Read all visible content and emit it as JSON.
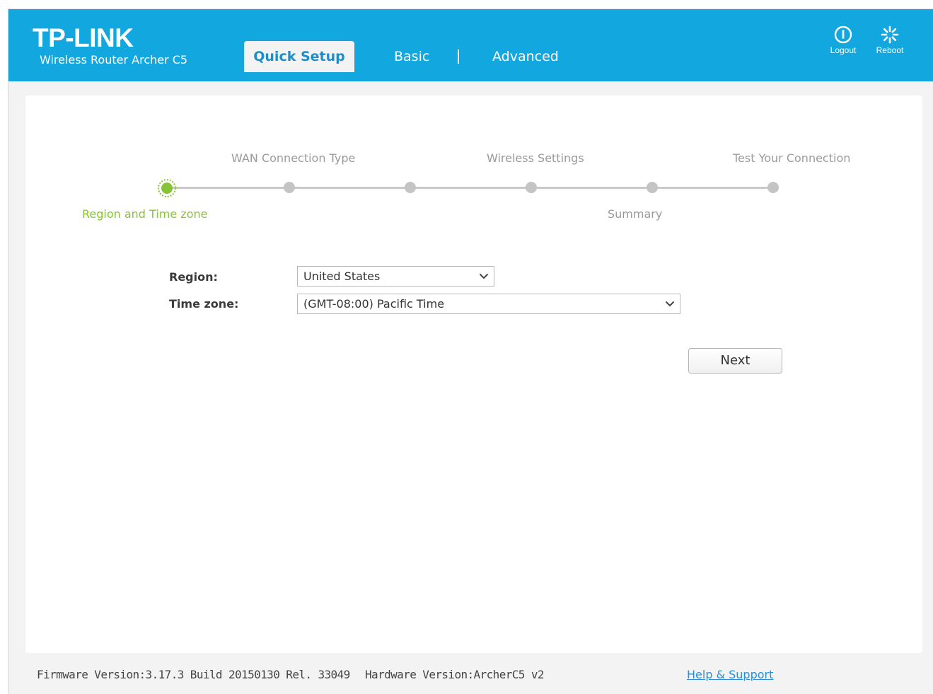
{
  "header": {
    "brand": "TP-LINK",
    "subtitle": "Wireless Router Archer C5",
    "tabs": [
      {
        "label": "Quick Setup",
        "active": true
      },
      {
        "label": "Basic",
        "active": false
      },
      {
        "label": "Advanced",
        "active": false
      }
    ],
    "logout_label": "Logout",
    "reboot_label": "Reboot",
    "color": "#12a7df"
  },
  "wizard": {
    "steps": [
      {
        "label": "Region and Time zone",
        "status": "current"
      },
      {
        "label": "WAN Connection Type",
        "status": "pending"
      },
      {
        "label": "",
        "status": "pending"
      },
      {
        "label": "Wireless Settings",
        "status": "pending"
      },
      {
        "label": "Summary",
        "status": "pending"
      },
      {
        "label": "Test Your Connection",
        "status": "pending"
      }
    ],
    "active_color": "#86c436"
  },
  "form": {
    "region_label": "Region:",
    "region_value": "United States",
    "timezone_label": "Time zone:",
    "timezone_value": "(GMT-08:00) Pacific Time",
    "next_label": "Next"
  },
  "footer": {
    "firmware": "Firmware Version:3.17.3 Build 20150130 Rel. 33049",
    "hardware": "Hardware Version:ArcherC5 v2",
    "help_link": "Help & Support"
  }
}
